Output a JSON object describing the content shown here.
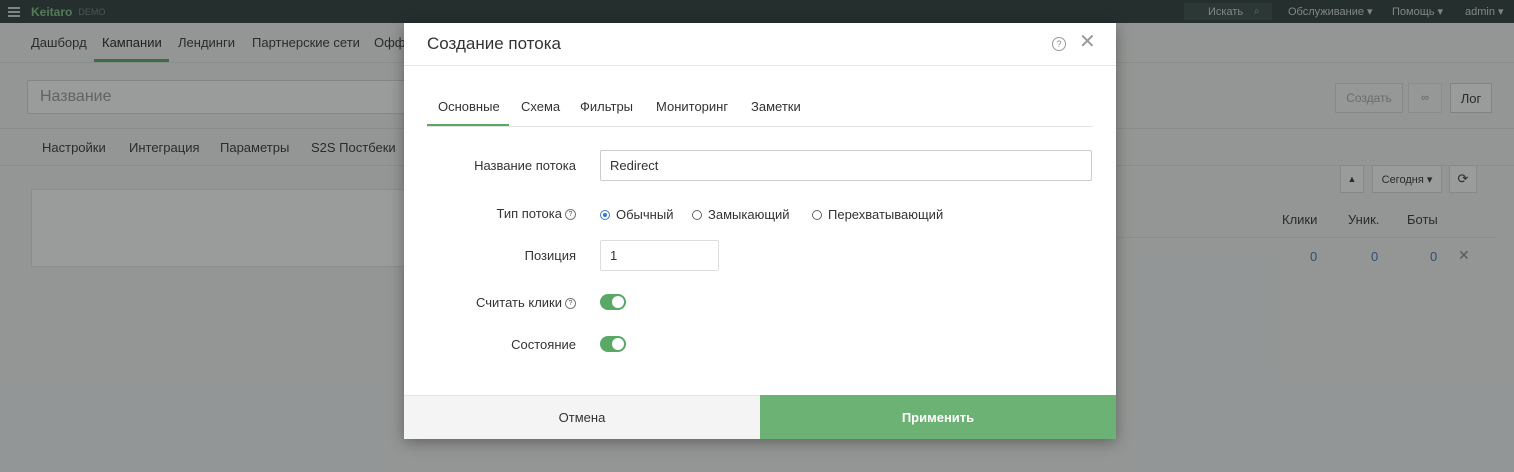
{
  "topbar": {
    "brand": "Keitaro",
    "brand_sub": "DEMO",
    "search_label": "Искать",
    "menu_service": "Обслуживание ▾",
    "menu_help": "Помощь ▾",
    "menu_user": "admin ▾"
  },
  "nav": {
    "items": [
      "Дашборд",
      "Кампании",
      "Лендинги",
      "Партнерские сети",
      "Офф"
    ]
  },
  "campaign": {
    "name_placeholder": "Название",
    "create_label": "Создать",
    "link_icon": "∞",
    "log_label": "Лог"
  },
  "subnav": {
    "items": [
      "Настройки",
      "Интеграция",
      "Параметры",
      "S2S Постбеки"
    ]
  },
  "stats": {
    "up_label": "▲",
    "period_label": "Сегодня ▾",
    "refresh_icon": "⟳",
    "headers": [
      "Клики",
      "Уник.",
      "Боты"
    ],
    "values": [
      "0",
      "0",
      "0"
    ],
    "row_close": "✕"
  },
  "modal": {
    "title": "Создание потока",
    "help_icon": "?",
    "close_icon": "✕",
    "tabs": [
      "Основные",
      "Схема",
      "Фильтры",
      "Мониторинг",
      "Заметки"
    ],
    "fields": {
      "flow_name_label": "Название потока",
      "flow_name_value": "Redirect",
      "flow_type_label": "Тип потока",
      "flow_type_options": [
        "Обычный",
        "Замыкающий",
        "Перехватывающий"
      ],
      "flow_type_selected": "Обычный",
      "position_label": "Позиция",
      "position_value": "1",
      "count_clicks_label": "Считать клики",
      "count_clicks_on": true,
      "state_label": "Состояние",
      "state_on": true
    },
    "cancel_label": "Отмена",
    "apply_label": "Применить"
  },
  "colors": {
    "accent_green": "#5aa866",
    "apply_green": "#6cb274",
    "radio_blue": "#3a79c6",
    "topbar_dark": "#2b3a37"
  }
}
